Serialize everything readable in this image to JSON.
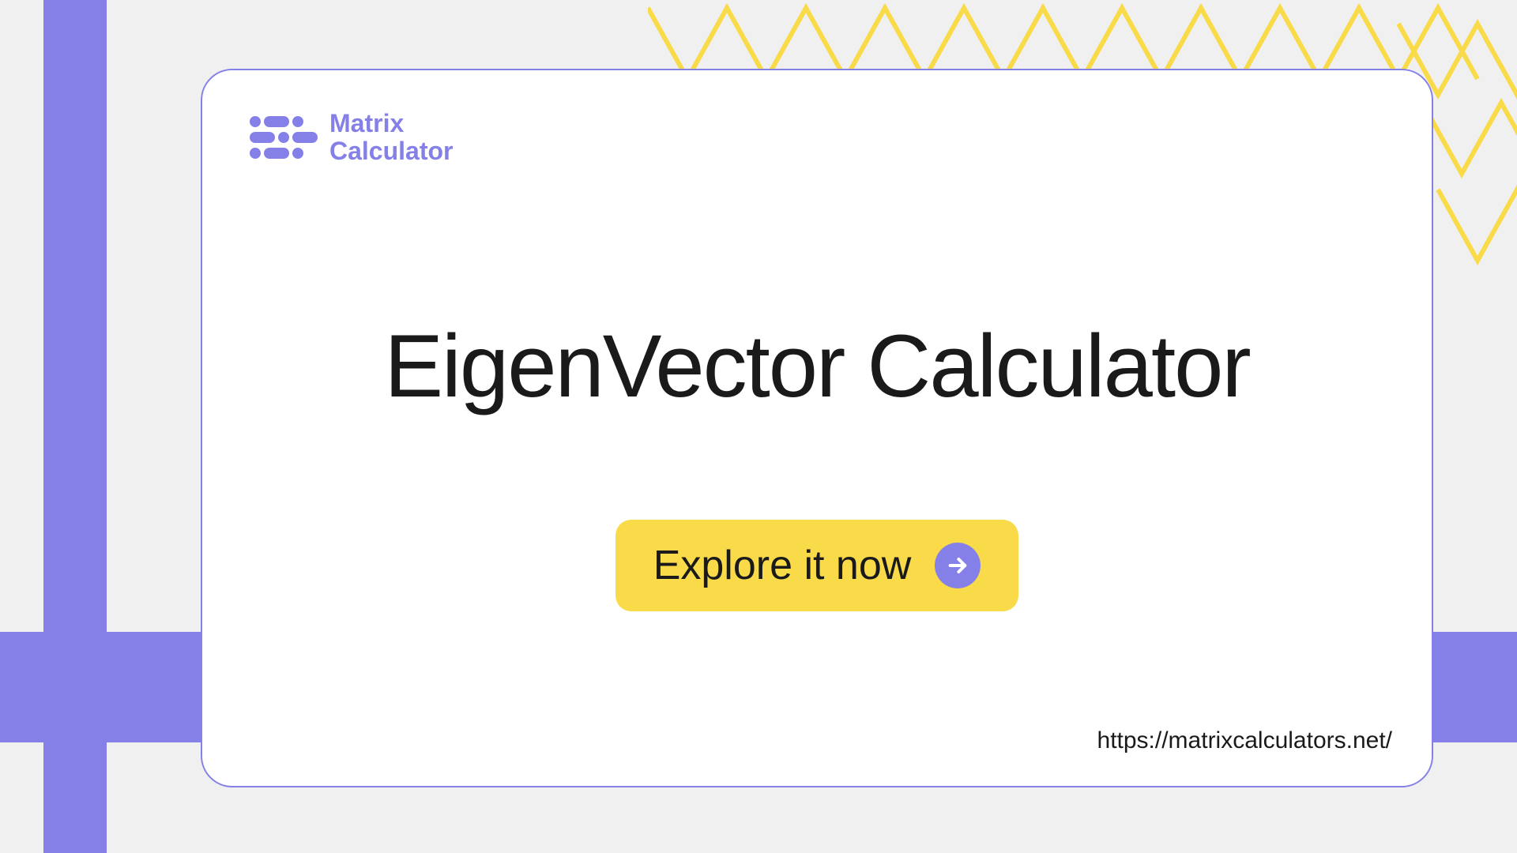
{
  "logo": {
    "line1": "Matrix",
    "line2": "Calculator"
  },
  "title": "EigenVector Calculator",
  "cta": {
    "label": "Explore it now"
  },
  "url": "https://matrixcalculators.net/",
  "colors": {
    "purple": "#8580e8",
    "yellow": "#f9db4a",
    "background": "#f0f0f0"
  }
}
